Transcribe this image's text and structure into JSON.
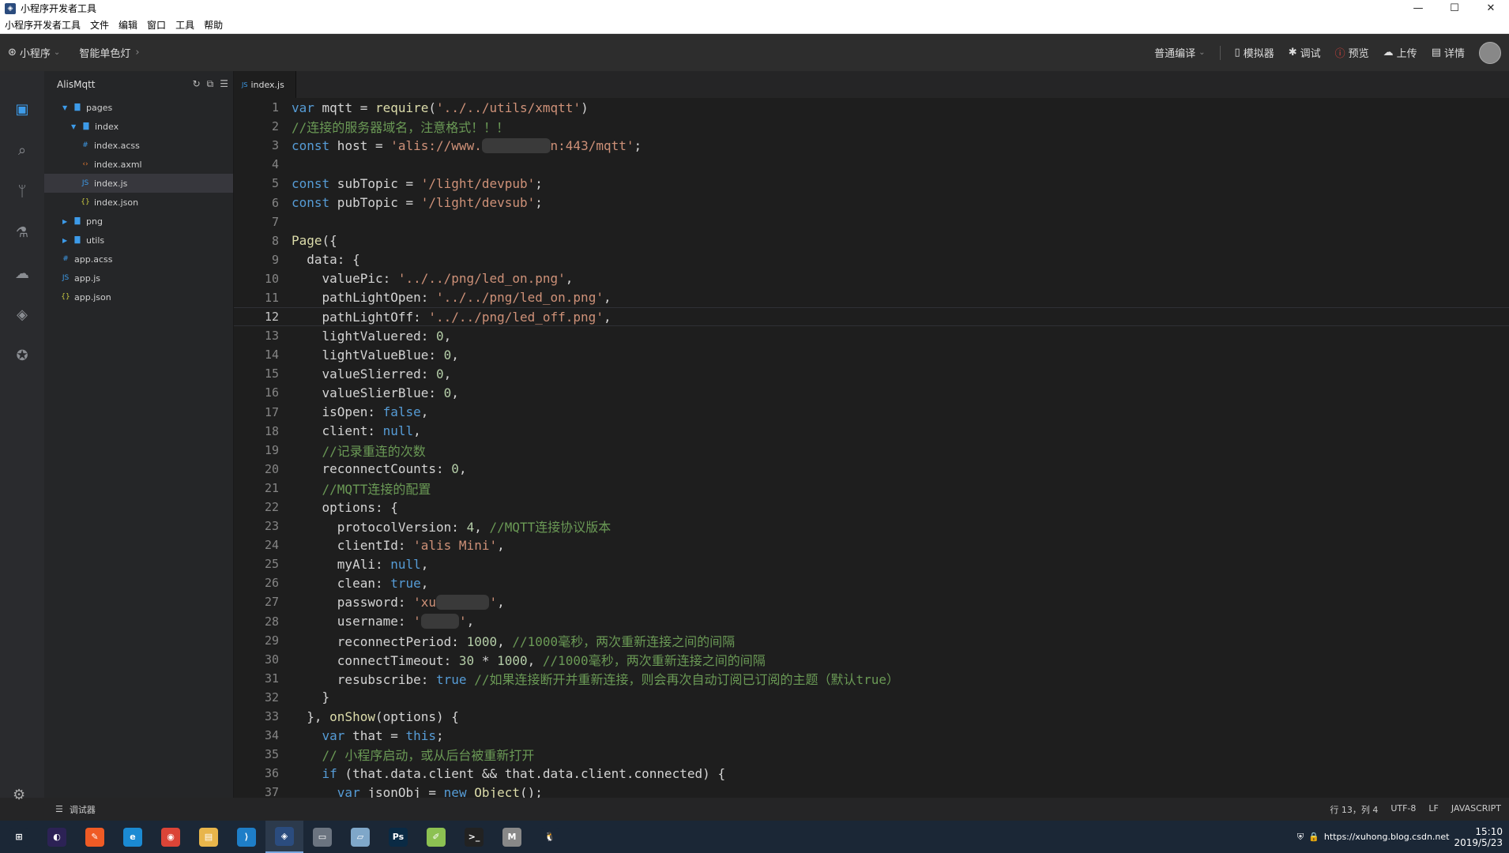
{
  "window": {
    "title": "小程序开发者工具",
    "controls": [
      "minimize-icon",
      "maximize-icon",
      "close-icon"
    ]
  },
  "menu": [
    "小程序开发者工具",
    "文件",
    "编辑",
    "窗口",
    "工具",
    "帮助"
  ],
  "toolbar": {
    "app": "小程序",
    "project": "智能单色灯",
    "compile_mode": "普通编译",
    "simulator": "模拟器",
    "debug": "调试",
    "preview": "预览",
    "upload": "上传",
    "details": "详情"
  },
  "explorer": {
    "project_name": "AlisMqtt",
    "tree": [
      {
        "label": "pages",
        "type": "folder",
        "depth": 1,
        "expanded": true
      },
      {
        "label": "index",
        "type": "folder",
        "depth": 2,
        "expanded": true
      },
      {
        "label": "index.acss",
        "type": "acss",
        "depth": 3
      },
      {
        "label": "index.axml",
        "type": "axml",
        "depth": 3
      },
      {
        "label": "index.js",
        "type": "js",
        "depth": 3,
        "selected": true
      },
      {
        "label": "index.json",
        "type": "json",
        "depth": 3
      },
      {
        "label": "png",
        "type": "folder",
        "depth": 1,
        "expanded": false
      },
      {
        "label": "utils",
        "type": "folder",
        "depth": 1,
        "expanded": false
      },
      {
        "label": "app.acss",
        "type": "acss",
        "depth": 0
      },
      {
        "label": "app.js",
        "type": "js",
        "depth": 0
      },
      {
        "label": "app.json",
        "type": "json",
        "depth": 0
      }
    ]
  },
  "editor": {
    "tab": "index.js",
    "current_line": 12,
    "lines": [
      [
        [
          "kw",
          "var"
        ],
        [
          "t",
          " mqtt = "
        ],
        [
          "fn",
          "require"
        ],
        [
          "t",
          "("
        ],
        [
          "str",
          "'../../utils/xmqtt'"
        ],
        [
          "t",
          ")"
        ]
      ],
      [
        [
          "cm",
          "//连接的服务器域名，注意格式！！！"
        ]
      ],
      [
        [
          "kw",
          "const"
        ],
        [
          "t",
          " host = "
        ],
        [
          "str",
          "'alis://www."
        ],
        [
          "blur",
          "xxxxxxxxx"
        ],
        [
          "str",
          "n:443/mqtt'"
        ],
        [
          "t",
          ";"
        ]
      ],
      [],
      [
        [
          "kw",
          "const"
        ],
        [
          "t",
          " subTopic = "
        ],
        [
          "str",
          "'/light/devpub'"
        ],
        [
          "t",
          ";"
        ]
      ],
      [
        [
          "kw",
          "const"
        ],
        [
          "t",
          " pubTopic = "
        ],
        [
          "str",
          "'/light/devsub'"
        ],
        [
          "t",
          ";"
        ]
      ],
      [],
      [
        [
          "fn",
          "Page"
        ],
        [
          "t",
          "({"
        ]
      ],
      [
        [
          "t",
          "  data: {"
        ]
      ],
      [
        [
          "t",
          "    valuePic: "
        ],
        [
          "str",
          "'../../png/led_on.png'"
        ],
        [
          "t",
          ","
        ]
      ],
      [
        [
          "t",
          "    pathLightOpen: "
        ],
        [
          "str",
          "'../../png/led_on.png'"
        ],
        [
          "t",
          ","
        ]
      ],
      [
        [
          "t",
          "    pathLightOff: "
        ],
        [
          "str",
          "'../../png/led_off.png'"
        ],
        [
          "t",
          ","
        ]
      ],
      [
        [
          "t",
          "    lightValuered: "
        ],
        [
          "num",
          "0"
        ],
        [
          "t",
          ","
        ]
      ],
      [
        [
          "t",
          "    lightValueBlue: "
        ],
        [
          "num",
          "0"
        ],
        [
          "t",
          ","
        ]
      ],
      [
        [
          "t",
          "    valueSlierred: "
        ],
        [
          "num",
          "0"
        ],
        [
          "t",
          ","
        ]
      ],
      [
        [
          "t",
          "    valueSlierBlue: "
        ],
        [
          "num",
          "0"
        ],
        [
          "t",
          ","
        ]
      ],
      [
        [
          "t",
          "    isOpen: "
        ],
        [
          "kw",
          "false"
        ],
        [
          "t",
          ","
        ]
      ],
      [
        [
          "t",
          "    client: "
        ],
        [
          "kw",
          "null"
        ],
        [
          "t",
          ","
        ]
      ],
      [
        [
          "t",
          "    "
        ],
        [
          "cm",
          "//记录重连的次数"
        ]
      ],
      [
        [
          "t",
          "    reconnectCounts: "
        ],
        [
          "num",
          "0"
        ],
        [
          "t",
          ","
        ]
      ],
      [
        [
          "t",
          "    "
        ],
        [
          "cm",
          "//MQTT连接的配置"
        ]
      ],
      [
        [
          "t",
          "    options: {"
        ]
      ],
      [
        [
          "t",
          "      protocolVersion: "
        ],
        [
          "num",
          "4"
        ],
        [
          "t",
          ", "
        ],
        [
          "cm",
          "//MQTT连接协议版本"
        ]
      ],
      [
        [
          "t",
          "      clientId: "
        ],
        [
          "str",
          "'alis Mini'"
        ],
        [
          "t",
          ","
        ]
      ],
      [
        [
          "t",
          "      myAli: "
        ],
        [
          "kw",
          "null"
        ],
        [
          "t",
          ","
        ]
      ],
      [
        [
          "t",
          "      clean: "
        ],
        [
          "kw",
          "true"
        ],
        [
          "t",
          ","
        ]
      ],
      [
        [
          "t",
          "      password: "
        ],
        [
          "str",
          "'xu"
        ],
        [
          "blur",
          "xxxxxxx"
        ],
        [
          "str",
          "'"
        ],
        [
          "t",
          ","
        ]
      ],
      [
        [
          "t",
          "      username: "
        ],
        [
          "str",
          "'"
        ],
        [
          "blur",
          "xxxxx"
        ],
        [
          "str",
          "'"
        ],
        [
          "t",
          ","
        ]
      ],
      [
        [
          "t",
          "      reconnectPeriod: "
        ],
        [
          "num",
          "1000"
        ],
        [
          "t",
          ", "
        ],
        [
          "cm",
          "//1000毫秒，两次重新连接之间的间隔"
        ]
      ],
      [
        [
          "t",
          "      connectTimeout: "
        ],
        [
          "num",
          "30"
        ],
        [
          "t",
          " * "
        ],
        [
          "num",
          "1000"
        ],
        [
          "t",
          ", "
        ],
        [
          "cm",
          "//1000毫秒，两次重新连接之间的间隔"
        ]
      ],
      [
        [
          "t",
          "      resubscribe: "
        ],
        [
          "kw",
          "true"
        ],
        [
          "t",
          " "
        ],
        [
          "cm",
          "//如果连接断开并重新连接，则会再次自动订阅已订阅的主题（默认true）"
        ]
      ],
      [
        [
          "t",
          "    }"
        ]
      ],
      [
        [
          "t",
          "  }, "
        ],
        [
          "fn",
          "onShow"
        ],
        [
          "t",
          "(options) {"
        ]
      ],
      [
        [
          "t",
          "    "
        ],
        [
          "kw",
          "var"
        ],
        [
          "t",
          " that = "
        ],
        [
          "kw",
          "this"
        ],
        [
          "t",
          ";"
        ]
      ],
      [
        [
          "t",
          "    "
        ],
        [
          "cm",
          "// 小程序启动，或从后台被重新打开"
        ]
      ],
      [
        [
          "t",
          "    "
        ],
        [
          "kw",
          "if"
        ],
        [
          "t",
          " (that.data.client && that.data.client.connected) {"
        ]
      ],
      [
        [
          "t",
          "      "
        ],
        [
          "kw",
          "var"
        ],
        [
          "t",
          " jsonObj = "
        ],
        [
          "kw",
          "new"
        ],
        [
          "t",
          " "
        ],
        [
          "fn",
          "Object"
        ],
        [
          "t",
          "();"
        ]
      ]
    ]
  },
  "statusbar": {
    "debugger": "调试器",
    "position": "行 13，列 4",
    "encoding": "UTF-8",
    "eol": "LF",
    "language": "JAVASCRIPT"
  },
  "taskbar": {
    "apps": [
      {
        "icon": "windows-start-icon",
        "color": "#1b2736",
        "glyph": "⊞"
      },
      {
        "icon": "eclipse-icon",
        "color": "#2c2255",
        "glyph": "◐"
      },
      {
        "icon": "postman-icon",
        "color": "#ef5b25",
        "glyph": "✎"
      },
      {
        "icon": "edge-icon",
        "color": "#1b8ad3",
        "glyph": "e"
      },
      {
        "icon": "chrome-icon",
        "color": "#db4437",
        "glyph": "◉"
      },
      {
        "icon": "file-explorer-icon",
        "color": "#e8b54b",
        "glyph": "▤"
      },
      {
        "icon": "vscode-icon",
        "color": "#1e7ec8",
        "glyph": "⟩"
      },
      {
        "icon": "miniprogram-devtools-icon",
        "color": "#2b4c7e",
        "glyph": "◈",
        "active": true
      },
      {
        "icon": "printer-icon",
        "color": "#6b7480",
        "glyph": "▭"
      },
      {
        "icon": "notebook-icon",
        "color": "#7fa7c9",
        "glyph": "▱"
      },
      {
        "icon": "photoshop-icon",
        "color": "#0a2a44",
        "glyph": "Ps"
      },
      {
        "icon": "notepadpp-icon",
        "color": "#8cc152",
        "glyph": "✐"
      },
      {
        "icon": "terminal-icon",
        "color": "#222",
        "glyph": ">_"
      },
      {
        "icon": "mqtt-tool-icon",
        "color": "#888",
        "glyph": "M"
      },
      {
        "icon": "qq-icon",
        "color": "#1b2736",
        "glyph": "🐧"
      }
    ],
    "tray_text": "https://xuhong.blog.csdn.net",
    "time": "15:10",
    "date": "2019/5/23"
  }
}
